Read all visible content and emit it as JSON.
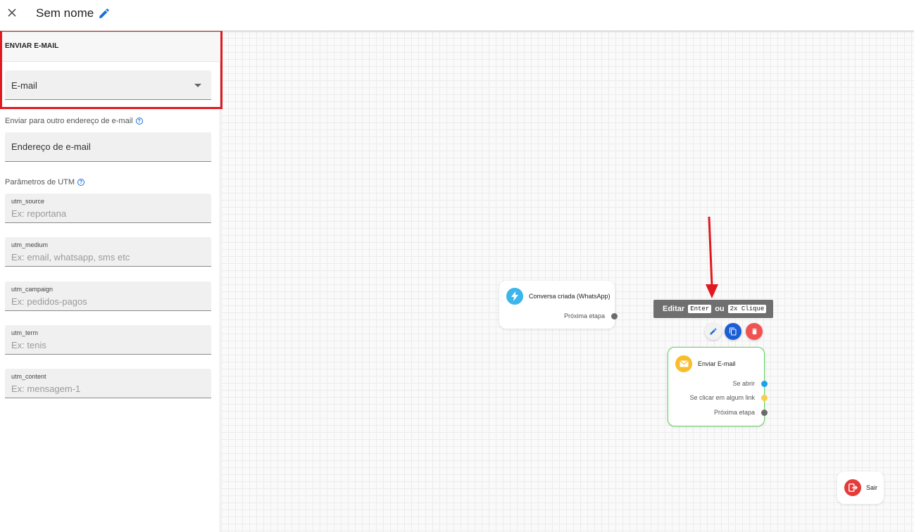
{
  "header": {
    "title": "Sem nome"
  },
  "panel": {
    "section_title": "ENVIAR E-MAIL",
    "email_select": {
      "value": "E-mail"
    },
    "other_address": {
      "label": "Enviar para outro endereço de e-mail",
      "placeholder": "Endereço de e-mail"
    },
    "utm": {
      "label": "Parâmetros de UTM",
      "fields": [
        {
          "name": "utm_source",
          "placeholder": "Ex: reportana"
        },
        {
          "name": "utm_medium",
          "placeholder": "Ex: email, whatsapp, sms etc"
        },
        {
          "name": "utm_campaign",
          "placeholder": "Ex: pedidos-pagos"
        },
        {
          "name": "utm_term",
          "placeholder": "Ex: tenis"
        },
        {
          "name": "utm_content",
          "placeholder": "Ex: mensagem-1"
        }
      ]
    }
  },
  "canvas": {
    "trigger_node": {
      "title": "Conversa criada (WhatsApp)",
      "icon": "lightning-icon",
      "port_label": "Próxima etapa"
    },
    "tooltip": {
      "prefix": "Editar",
      "key1": "Enter",
      "connector": "ou",
      "key2": "2x Clique"
    },
    "email_node": {
      "title": "Enviar E-mail",
      "icon": "envelope-icon",
      "ports": [
        {
          "label": "Se abrir",
          "color": "#1aa3f0"
        },
        {
          "label": "Se clicar em algum link",
          "color": "#f7cf4a"
        },
        {
          "label": "Próxima etapa",
          "color": "#6b6b6b"
        }
      ]
    },
    "exit_node": {
      "title": "Sair",
      "icon": "exit-icon"
    }
  },
  "colors": {
    "accent_blue": "#1b6fd6",
    "highlight_red": "#e0191f",
    "selected_node_border": "#5fd35f",
    "delete_red": "#f05252"
  }
}
